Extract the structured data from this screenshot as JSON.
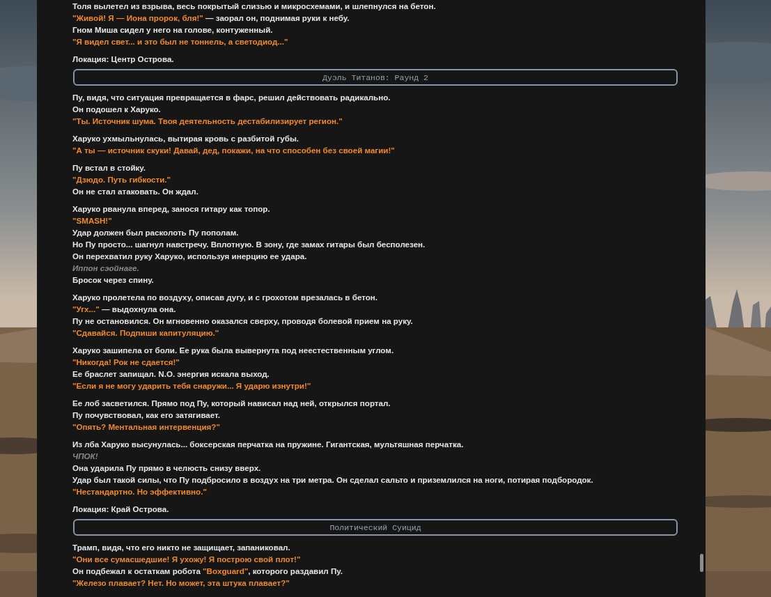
{
  "blocks": [
    {
      "kind": "paragraph",
      "lines": [
        {
          "kind": "narration",
          "text": "Толя вылетел из взрыва, весь покрытый слизью и микросхемами, и шлепнулся на бетон."
        },
        {
          "kind": "mixed",
          "parts": [
            {
              "kind": "speech",
              "text": "\"Живой! Я — Иона пророк, бля!\""
            },
            {
              "kind": "narration",
              "text": " — заорал он, поднимая руки к небу."
            }
          ]
        },
        {
          "kind": "narration",
          "text": "Гном Миша сидел у него на голове, контуженный."
        },
        {
          "kind": "speech",
          "text": "\"Я видел свет... и это был не тоннель, а светодиод...\""
        }
      ]
    },
    {
      "kind": "location",
      "text": "Локация: Центр Острова."
    },
    {
      "kind": "section",
      "text": "Дуэль Титанов: Раунд 2"
    },
    {
      "kind": "paragraph",
      "lines": [
        {
          "kind": "narration",
          "text": "Пу, видя, что ситуация превращается в фарс, решил действовать радикально."
        },
        {
          "kind": "narration",
          "text": "Он подошел к Харуко."
        },
        {
          "kind": "speech",
          "text": "\"Ты. Источник шума. Твоя деятельность дестабилизирует регион.\""
        }
      ]
    },
    {
      "kind": "paragraph",
      "lines": [
        {
          "kind": "narration",
          "text": "Харуко ухмыльнулась, вытирая кровь с разбитой губы."
        },
        {
          "kind": "speech",
          "text": "\"А ты — источник скуки! Давай, дед, покажи, на что способен без своей магии!\""
        }
      ]
    },
    {
      "kind": "paragraph",
      "lines": [
        {
          "kind": "narration",
          "text": "Пу встал в стойку."
        },
        {
          "kind": "speech",
          "text": "\"Дзюдо. Путь гибкости.\""
        },
        {
          "kind": "narration",
          "text": "Он не стал атаковать. Он ждал."
        }
      ]
    },
    {
      "kind": "paragraph",
      "lines": [
        {
          "kind": "narration",
          "text": "Харуко рванула вперед, занося гитару как топор."
        },
        {
          "kind": "speech",
          "text": "\"SMASH!\""
        },
        {
          "kind": "narration",
          "text": "Удар должен был расколоть Пу пополам."
        },
        {
          "kind": "narration",
          "text": "Но Пу просто... шагнул навстречу. Вплотную. В зону, где замах гитары был бесполезен."
        },
        {
          "kind": "narration",
          "text": "Он перехватил руку Харуко, используя инерцию ее удара."
        },
        {
          "kind": "sound",
          "text": "Иппон сэойнаге."
        },
        {
          "kind": "narration",
          "text": "Бросок через спину."
        }
      ]
    },
    {
      "kind": "paragraph",
      "lines": [
        {
          "kind": "narration",
          "text": "Харуко пролетела по воздуху, описав дугу, и с грохотом врезалась в бетон."
        },
        {
          "kind": "mixed",
          "parts": [
            {
              "kind": "speech",
              "text": "\"Угх...\""
            },
            {
              "kind": "narration",
              "text": " — выдохнула она."
            }
          ]
        },
        {
          "kind": "narration",
          "text": "Пу не остановился. Он мгновенно оказался сверху, проводя болевой прием на руку."
        },
        {
          "kind": "speech",
          "text": "\"Сдавайся. Подпиши капитуляцию.\""
        }
      ]
    },
    {
      "kind": "paragraph",
      "lines": [
        {
          "kind": "narration",
          "text": "Харуко зашипела от боли. Ее рука была вывернута под неестественным углом."
        },
        {
          "kind": "speech",
          "text": "\"Никогда! Рок не сдается!\""
        },
        {
          "kind": "narration",
          "text": "Ее браслет запищал. N.O. энергия искала выход."
        },
        {
          "kind": "speech",
          "text": "\"Если я не могу ударить тебя снаружи... Я ударю изнутри!\""
        }
      ]
    },
    {
      "kind": "paragraph",
      "lines": [
        {
          "kind": "narration",
          "text": "Ее лоб засветился. Прямо под Пу, который нависал над ней, открылся портал."
        },
        {
          "kind": "narration",
          "text": "Пу почувствовал, как его затягивает."
        },
        {
          "kind": "speech",
          "text": "\"Опять? Ментальная интервенция?\""
        }
      ]
    },
    {
      "kind": "paragraph",
      "lines": [
        {
          "kind": "narration",
          "text": "Из лба Харуко высунулась... боксерская перчатка на пружине. Гигантская, мультяшная перчатка."
        },
        {
          "kind": "sound",
          "text": "ЧПОК!"
        },
        {
          "kind": "narration",
          "text": "Она ударила Пу прямо в челюсть снизу вверх."
        },
        {
          "kind": "narration",
          "text": "Удар был такой силы, что Пу подбросило в воздух на три метра. Он сделал сальто и приземлился на ноги, потирая подбородок."
        },
        {
          "kind": "speech",
          "text": "\"Нестандартно. Но эффективно.\""
        }
      ]
    },
    {
      "kind": "location",
      "text": "Локация: Край Острова."
    },
    {
      "kind": "section",
      "text": "Политический Суицид"
    },
    {
      "kind": "paragraph",
      "lines": [
        {
          "kind": "narration",
          "text": "Трамп, видя, что его никто не защищает, запаниковал."
        },
        {
          "kind": "speech",
          "text": "\"Они все сумасшедшие! Я ухожу! Я построю свой плот!\""
        },
        {
          "kind": "mixed",
          "parts": [
            {
              "kind": "narration",
              "text": "Он подбежал к остаткам робота "
            },
            {
              "kind": "speech",
              "text": "\"Boxguard\""
            },
            {
              "kind": "narration",
              "text": ", которого раздавил Пу."
            }
          ]
        },
        {
          "kind": "speech",
          "text": "\"Железо плавает? Нет. Но может, эта штука плавает?\""
        }
      ]
    }
  ]
}
